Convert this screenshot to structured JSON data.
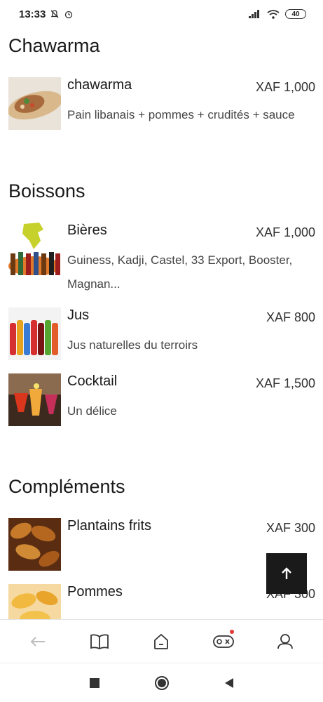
{
  "status_bar": {
    "time": "13:33",
    "battery": "40",
    "icons": [
      "bell-off-icon",
      "alarm-icon",
      "signal-icon",
      "wifi-icon",
      "battery-icon"
    ]
  },
  "sections": [
    {
      "title": "Chawarma",
      "items": [
        {
          "name": "chawarma",
          "price": "XAF 1,000",
          "description": "Pain libanais + pommes + crudités + sauce"
        }
      ]
    },
    {
      "title": "Boissons",
      "items": [
        {
          "name": "Bières",
          "price": "XAF 1,000",
          "description": "Guiness, Kadji, Castel, 33 Export, Booster, Magnan..."
        },
        {
          "name": "Jus",
          "price": "XAF 800",
          "description": "Jus naturelles du terroirs"
        },
        {
          "name": "Cocktail",
          "price": "XAF 1,500",
          "description": "Un délice"
        }
      ]
    },
    {
      "title": "Compléments",
      "items": [
        {
          "name": "Plantains frits",
          "price": "XAF 300",
          "description": ""
        },
        {
          "name": "Pommes",
          "price": "XAF 300",
          "description": ""
        }
      ]
    }
  ],
  "bottom_nav": {
    "items": [
      "back-arrow-icon",
      "book-icon",
      "home-icon",
      "gamepad-icon",
      "profile-icon"
    ],
    "badge_color": "#e53935"
  },
  "system_nav": {
    "items": [
      "recents-square-icon",
      "home-circle-icon",
      "back-triangle-icon"
    ]
  }
}
